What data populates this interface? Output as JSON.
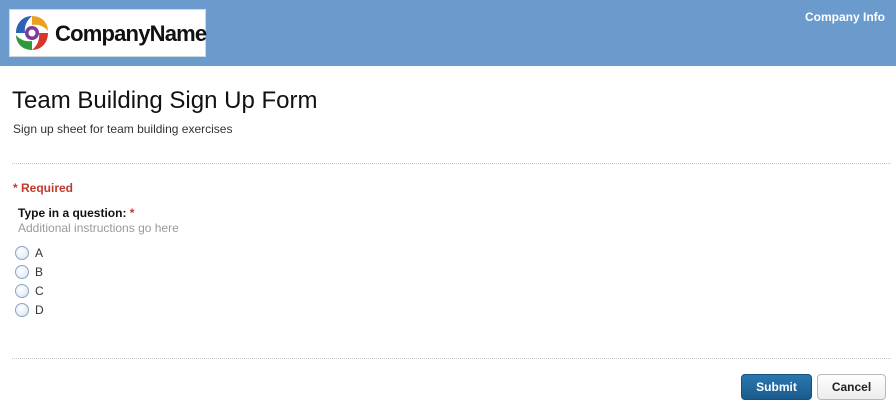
{
  "header": {
    "logo_text": "CompanyName",
    "company_info_link": "Company Info",
    "background_color": "#6a9bcc"
  },
  "form": {
    "title": "Team Building Sign Up Form",
    "description": "Sign up sheet for team building exercises",
    "required_note": "* Required",
    "question": {
      "label": "Type in a question:",
      "required_marker": "*",
      "help_text": "Additional instructions go here",
      "options": [
        "A",
        "B",
        "C",
        "D"
      ],
      "selected": null
    }
  },
  "buttons": {
    "submit_label": "Submit",
    "cancel_label": "Cancel"
  },
  "colors": {
    "accent": "#1f6699",
    "required": "#c0392b"
  }
}
